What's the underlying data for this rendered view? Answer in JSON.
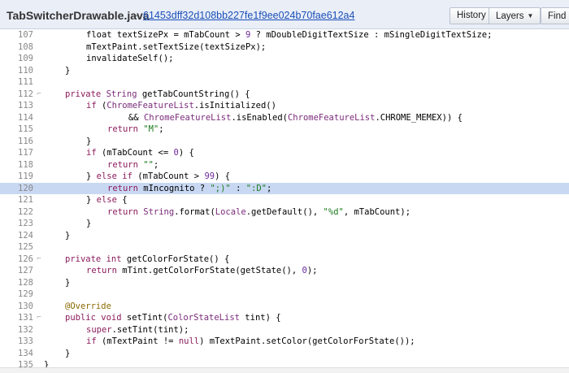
{
  "header": {
    "file_name": "TabSwitcherDrawable.java",
    "dash": "–",
    "commit_hash": "61453dff32d108bb227fe1f9ee024b70fae612a4",
    "history_label": "History",
    "layers_label": "Layers",
    "find_label": "Find"
  },
  "code": {
    "highlighted_line": "120",
    "lines": [
      {
        "n": "107",
        "fold": "",
        "indent": 8,
        "seg": [
          [
            "float textSizePx = mTabCount > ",
            ""
          ],
          [
            "9",
            "num"
          ],
          [
            " ? mDoubleDigitTextSize : mSingleDigitTextSize;",
            ""
          ]
        ]
      },
      {
        "n": "108",
        "fold": "",
        "indent": 8,
        "seg": [
          [
            "mTextPaint.setTextSize(textSizePx);",
            ""
          ]
        ]
      },
      {
        "n": "109",
        "fold": "",
        "indent": 8,
        "seg": [
          [
            "invalidateSelf();",
            ""
          ]
        ]
      },
      {
        "n": "110",
        "fold": "",
        "indent": 4,
        "seg": [
          [
            "}",
            ""
          ]
        ]
      },
      {
        "n": "111",
        "fold": "",
        "indent": 0,
        "seg": []
      },
      {
        "n": "112",
        "fold": "-",
        "indent": 4,
        "seg": [
          [
            "private",
            "kw"
          ],
          [
            " ",
            ""
          ],
          [
            "String",
            "ty"
          ],
          [
            " getTabCountString() {",
            ""
          ]
        ]
      },
      {
        "n": "113",
        "fold": "",
        "indent": 8,
        "seg": [
          [
            "if",
            "kw"
          ],
          [
            " (",
            ""
          ],
          [
            "ChromeFeatureList",
            "ty"
          ],
          [
            ".isInitialized()",
            ""
          ]
        ]
      },
      {
        "n": "114",
        "fold": "",
        "indent": 16,
        "seg": [
          [
            "&& ",
            ""
          ],
          [
            "ChromeFeatureList",
            "ty"
          ],
          [
            ".isEnabled(",
            ""
          ],
          [
            "ChromeFeatureList",
            "ty"
          ],
          [
            ".CHROME_MEMEX)) {",
            ""
          ]
        ]
      },
      {
        "n": "115",
        "fold": "",
        "indent": 12,
        "seg": [
          [
            "return",
            "kw"
          ],
          [
            " ",
            ""
          ],
          [
            "\"M\"",
            "str"
          ],
          [
            ";",
            ""
          ]
        ]
      },
      {
        "n": "116",
        "fold": "",
        "indent": 8,
        "seg": [
          [
            "}",
            ""
          ]
        ]
      },
      {
        "n": "117",
        "fold": "",
        "indent": 8,
        "seg": [
          [
            "if",
            "kw"
          ],
          [
            " (mTabCount <= ",
            ""
          ],
          [
            "0",
            "num"
          ],
          [
            ") {",
            ""
          ]
        ]
      },
      {
        "n": "118",
        "fold": "",
        "indent": 12,
        "seg": [
          [
            "return",
            "kw"
          ],
          [
            " ",
            ""
          ],
          [
            "\"\"",
            "str"
          ],
          [
            ";",
            ""
          ]
        ]
      },
      {
        "n": "119",
        "fold": "",
        "indent": 8,
        "seg": [
          [
            "} ",
            ""
          ],
          [
            "else",
            "kw"
          ],
          [
            " ",
            ""
          ],
          [
            "if",
            "kw"
          ],
          [
            " (mTabCount > ",
            ""
          ],
          [
            "99",
            "num"
          ],
          [
            ") {",
            ""
          ]
        ]
      },
      {
        "n": "120",
        "fold": "",
        "indent": 12,
        "seg": [
          [
            "return",
            "kw"
          ],
          [
            " mIncognito ? ",
            ""
          ],
          [
            "\";)\"",
            "str"
          ],
          [
            " : ",
            ""
          ],
          [
            "\":D\"",
            "str"
          ],
          [
            ";",
            ""
          ]
        ]
      },
      {
        "n": "121",
        "fold": "",
        "indent": 8,
        "seg": [
          [
            "} ",
            ""
          ],
          [
            "else",
            "kw"
          ],
          [
            " {",
            ""
          ]
        ]
      },
      {
        "n": "122",
        "fold": "",
        "indent": 12,
        "seg": [
          [
            "return",
            "kw"
          ],
          [
            " ",
            ""
          ],
          [
            "String",
            "ty"
          ],
          [
            ".format(",
            ""
          ],
          [
            "Locale",
            "ty"
          ],
          [
            ".getDefault(), ",
            ""
          ],
          [
            "\"%d\"",
            "str"
          ],
          [
            ", mTabCount);",
            ""
          ]
        ]
      },
      {
        "n": "123",
        "fold": "",
        "indent": 8,
        "seg": [
          [
            "}",
            ""
          ]
        ]
      },
      {
        "n": "124",
        "fold": "",
        "indent": 4,
        "seg": [
          [
            "}",
            ""
          ]
        ]
      },
      {
        "n": "125",
        "fold": "",
        "indent": 0,
        "seg": []
      },
      {
        "n": "126",
        "fold": "-",
        "indent": 4,
        "seg": [
          [
            "private",
            "kw"
          ],
          [
            " ",
            ""
          ],
          [
            "int",
            "kw"
          ],
          [
            " getColorForState() {",
            ""
          ]
        ]
      },
      {
        "n": "127",
        "fold": "",
        "indent": 8,
        "seg": [
          [
            "return",
            "kw"
          ],
          [
            " mTint.getColorForState(getState(), ",
            ""
          ],
          [
            "0",
            "num"
          ],
          [
            ");",
            ""
          ]
        ]
      },
      {
        "n": "128",
        "fold": "",
        "indent": 4,
        "seg": [
          [
            "}",
            ""
          ]
        ]
      },
      {
        "n": "129",
        "fold": "",
        "indent": 0,
        "seg": []
      },
      {
        "n": "130",
        "fold": "",
        "indent": 4,
        "seg": [
          [
            "@Override",
            "an"
          ]
        ]
      },
      {
        "n": "131",
        "fold": "-",
        "indent": 4,
        "seg": [
          [
            "public",
            "kw"
          ],
          [
            " ",
            ""
          ],
          [
            "void",
            "kw"
          ],
          [
            " setTint(",
            ""
          ],
          [
            "ColorStateList",
            "ty"
          ],
          [
            " tint) {",
            ""
          ]
        ]
      },
      {
        "n": "132",
        "fold": "",
        "indent": 8,
        "seg": [
          [
            "super",
            "kw"
          ],
          [
            ".setTint(tint);",
            ""
          ]
        ]
      },
      {
        "n": "133",
        "fold": "",
        "indent": 8,
        "seg": [
          [
            "if",
            "kw"
          ],
          [
            " (mTextPaint != ",
            ""
          ],
          [
            "null",
            "kw"
          ],
          [
            ") mTextPaint.setColor(getColorForState());",
            ""
          ]
        ]
      },
      {
        "n": "134",
        "fold": "",
        "indent": 4,
        "seg": [
          [
            "}",
            ""
          ]
        ]
      },
      {
        "n": "135",
        "fold": "",
        "indent": 0,
        "seg": [
          [
            "}",
            ""
          ]
        ]
      }
    ]
  }
}
